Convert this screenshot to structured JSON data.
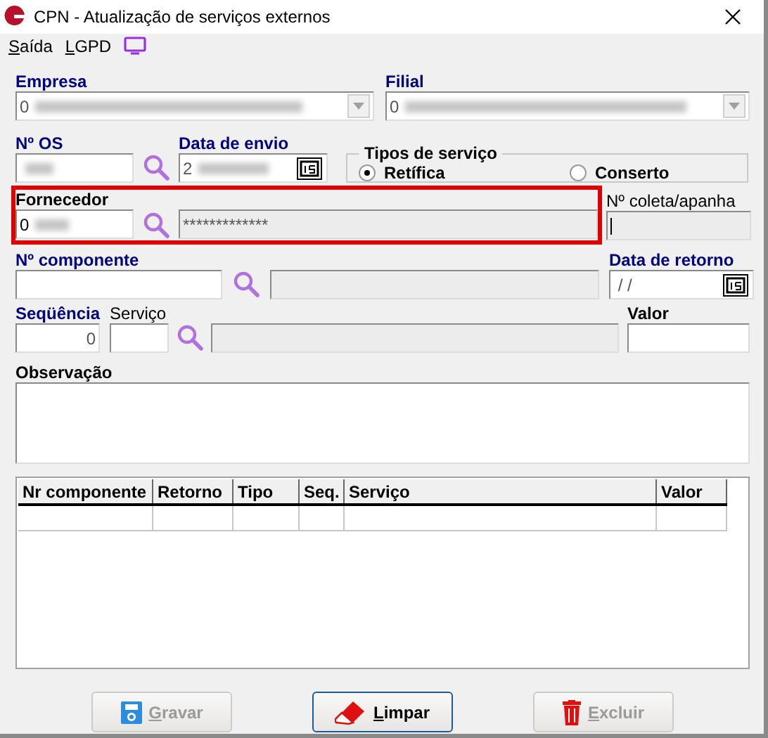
{
  "window": {
    "title": "CPN - Atualização de serviços externos"
  },
  "menu": [
    {
      "label": "Saída"
    },
    {
      "label": "LGPD"
    }
  ],
  "empresa": {
    "label": "Empresa",
    "value": "0"
  },
  "filial": {
    "label": "Filial",
    "value": "0"
  },
  "numero_os": {
    "label": "Nº  OS"
  },
  "data_envio": {
    "label": "Data de envio",
    "value": "2"
  },
  "tipos_servico": {
    "label": "Tipos de serviço",
    "options": [
      {
        "label": "Retífica",
        "selected": true
      },
      {
        "label": "Conserto",
        "selected": false
      }
    ]
  },
  "fornecedor": {
    "label": "Fornecedor",
    "code": "0",
    "name": "*************"
  },
  "coleta": {
    "label": "Nº coleta/apanha"
  },
  "componente": {
    "label": "Nº  componente"
  },
  "data_retorno": {
    "label": "Data de retorno",
    "value": " / /"
  },
  "sequencia": {
    "label": "Seqüência",
    "value": "0"
  },
  "servico": {
    "label": "Serviço"
  },
  "valor": {
    "label": "Valor"
  },
  "observacao": {
    "label": "Observação"
  },
  "table": {
    "columns": [
      "Nr componente",
      "Retorno",
      "Tipo",
      "Seq.",
      "Serviço",
      "Valor"
    ]
  },
  "buttons": [
    {
      "label": "Gravar",
      "kind": "save",
      "disabled": true
    },
    {
      "label": "Limpar",
      "kind": "clear",
      "disabled": false
    },
    {
      "label": "Excluir",
      "kind": "delete",
      "disabled": true
    }
  ]
}
